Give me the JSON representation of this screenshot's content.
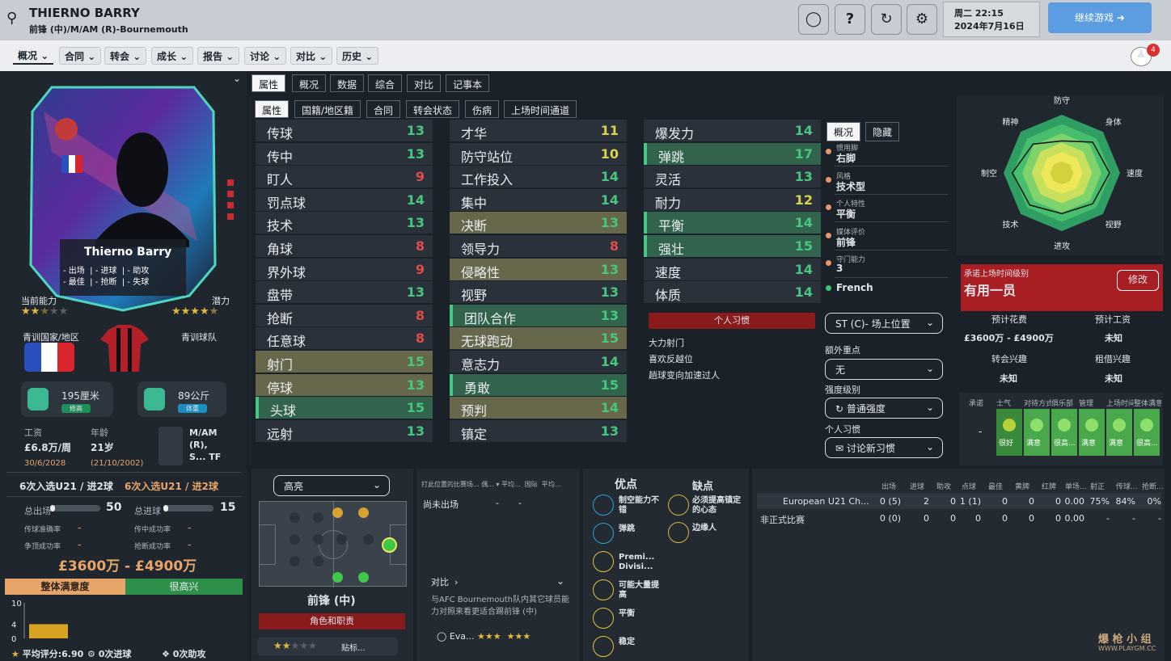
{
  "header": {
    "title": "THIERNO BARRY",
    "subtitle": "前锋 (中)/M/AM (R)-Bournemouth",
    "date_line1": "周二 22:15",
    "date_line2": "2024年7月16日",
    "continue_label": "继续游戏",
    "notif_count": "4"
  },
  "nav": [
    "概况",
    "合同",
    "转会",
    "成长",
    "报告",
    "讨论",
    "对比",
    "历史"
  ],
  "tabs1": [
    "属性",
    "概况",
    "数据",
    "综合",
    "对比",
    "记事本"
  ],
  "tabs2": [
    "属性",
    "国籍/地区籍",
    "合同",
    "转会状态",
    "伤病",
    "上场时间通道"
  ],
  "card": {
    "name": "Thierno Barry",
    "rows": [
      [
        "出场",
        "进球",
        "助攻"
      ],
      [
        "最佳",
        "抢断",
        "失球"
      ]
    ],
    "dash": "-"
  },
  "left": {
    "current_ability": "当前能力",
    "potential": "潜力",
    "youth_nation": "青训国家/地区",
    "youth_team": "青训球队",
    "height": "195厘米",
    "height_tag": "修高",
    "weight": "89公斤",
    "weight_tag": "体重",
    "wage_label": "工资",
    "wage": "£6.8万/周",
    "wage_date": "30/6/2028",
    "age_label": "年龄",
    "age": "21岁",
    "dob": "(21/10/2002)",
    "pos_text": "M/AM (R), S... TF",
    "u21_a": "6次入选U21 / 进2球",
    "u21_b": "6次入选U21 / 进2球",
    "apps_label": "总出场",
    "apps": "50",
    "goals_label": "总进球",
    "goals": "15",
    "stat_rows": [
      [
        "传球准确率",
        "-",
        "传中成功率",
        "-"
      ],
      [
        "争顶成功率",
        "-",
        "抢断成功率",
        "-"
      ]
    ],
    "value": "£3600万 - £4900万",
    "sat_label": "整体满意度",
    "sat_value": "很高兴",
    "avg_rating": "平均评分:6.90",
    "goals_foot": "0次进球",
    "assists_foot": "0次助攻",
    "yticks": [
      "10",
      "4",
      "0"
    ],
    "bar_value": 4
  },
  "attrs_col1": [
    [
      "传球",
      "13",
      "g",
      ""
    ],
    [
      "传中",
      "13",
      "g",
      ""
    ],
    [
      "盯人",
      "9",
      "r",
      ""
    ],
    [
      "罚点球",
      "14",
      "g",
      ""
    ],
    [
      "技术",
      "13",
      "g",
      ""
    ],
    [
      "角球",
      "8",
      "r",
      ""
    ],
    [
      "界外球",
      "9",
      "r",
      ""
    ],
    [
      "盘带",
      "13",
      "g",
      ""
    ],
    [
      "抢断",
      "8",
      "r",
      ""
    ],
    [
      "任意球",
      "8",
      "r",
      ""
    ],
    [
      "射门",
      "15",
      "g",
      "olive"
    ],
    [
      "停球",
      "13",
      "g",
      "olive"
    ],
    [
      "头球",
      "15",
      "g",
      "green"
    ],
    [
      "远射",
      "13",
      "g",
      ""
    ]
  ],
  "attrs_col2": [
    [
      "才华",
      "11",
      "y",
      ""
    ],
    [
      "防守站位",
      "10",
      "y",
      ""
    ],
    [
      "工作投入",
      "14",
      "g",
      ""
    ],
    [
      "集中",
      "14",
      "g",
      ""
    ],
    [
      "决断",
      "13",
      "g",
      "olive"
    ],
    [
      "领导力",
      "8",
      "r",
      ""
    ],
    [
      "侵略性",
      "13",
      "g",
      "olive"
    ],
    [
      "视野",
      "13",
      "g",
      ""
    ],
    [
      "团队合作",
      "13",
      "g",
      "green"
    ],
    [
      "无球跑动",
      "15",
      "g",
      "olive"
    ],
    [
      "意志力",
      "14",
      "g",
      ""
    ],
    [
      "勇敢",
      "15",
      "g",
      "green"
    ],
    [
      "预判",
      "14",
      "g",
      "olive"
    ],
    [
      "镇定",
      "13",
      "g",
      ""
    ]
  ],
  "attrs_col3": [
    [
      "爆发力",
      "14",
      "g",
      ""
    ],
    [
      "弹跳",
      "17",
      "g",
      "green"
    ],
    [
      "灵活",
      "13",
      "g",
      ""
    ],
    [
      "耐力",
      "12",
      "y",
      ""
    ],
    [
      "平衡",
      "14",
      "g",
      "green"
    ],
    [
      "强壮",
      "15",
      "g",
      "green"
    ],
    [
      "速度",
      "14",
      "g",
      ""
    ],
    [
      "体质",
      "14",
      "g",
      ""
    ]
  ],
  "habits": {
    "label": "个人习惯",
    "items": [
      "大力射门",
      "喜欢反越位",
      "趟球变向加速过人"
    ]
  },
  "info": {
    "tab_a": "概况",
    "tab_b": "隐藏",
    "rows": [
      [
        "惯用脚",
        "右脚"
      ],
      [
        "风格",
        "技术型"
      ],
      [
        "个人特性",
        "平衡"
      ],
      [
        "媒体评价",
        "前锋"
      ],
      [
        "守门能力",
        "3"
      ]
    ],
    "nation": "French",
    "role_dd": "ST (C)- 场上位置",
    "extra_label": "额外重点",
    "extra_dd": "无",
    "intensity_label": "强度级别",
    "intensity_dd": "普通强度",
    "habit_label": "个人习惯",
    "habit_dd": "讨论新习惯"
  },
  "radar": {
    "labels": [
      "防守",
      "身体",
      "速度",
      "视野",
      "进攻",
      "技术",
      "制空",
      "精神"
    ],
    "values": [
      0.55,
      0.75,
      0.82,
      0.75,
      0.7,
      0.78,
      0.85,
      0.7
    ]
  },
  "promise": {
    "title": "承诺上场时间级别",
    "value": "有用一员",
    "edit": "修改",
    "cost_label": "预计花费",
    "wage_label": "预计工资",
    "cost": "£3600万 - £4900万",
    "wage": "未知",
    "transfer_label": "转会兴趣",
    "loan_label": "租借兴趣",
    "transfer": "未知",
    "loan": "未知"
  },
  "morale": {
    "headers": [
      "承诺",
      "士气",
      "对待方式",
      "俱乐部",
      "管理",
      "上场时间",
      "整体满意度"
    ],
    "values": [
      "-",
      "很好",
      "满意",
      "很高...",
      "满意",
      "满意",
      "很高..."
    ]
  },
  "highlight": {
    "dd": "高亮",
    "position": "前锋 (中)",
    "role_btn": "角色和职责",
    "role_sel": "贴标..."
  },
  "matches": {
    "headers": [
      "打此位置的比赛场...",
      "偶...",
      "平均...",
      "国际",
      "平均..."
    ],
    "row": [
      "尚未出场",
      "-",
      "-"
    ],
    "compare_label": "对比",
    "compare_text": "与AFC Bournemouth队内其它球员能力对照来看更适合踢前锋 (中)",
    "eva": "Eva..."
  },
  "pros_cons": {
    "pro_title": "优点",
    "con_title": "缺点",
    "pros": [
      "制空能力不错",
      "弹跳",
      "Premi... Divisi...",
      "可能大量提高",
      "平衡",
      "稳定"
    ],
    "cons": [
      "必须提高镇定的心态",
      "边缘人"
    ]
  },
  "stats": {
    "headers": [
      "出场",
      "进球",
      "助攻",
      "点球",
      "最佳",
      "黄牌",
      "红牌",
      "单场...",
      "射正",
      "传球...",
      "抢断..."
    ],
    "rows": [
      [
        "European U21 Ch...",
        "0 (5)",
        "2",
        "0",
        "1 (1)",
        "0",
        "0",
        "0",
        "0.00",
        "75%",
        "84%",
        "0%"
      ],
      [
        "非正式比赛",
        "0 (0)",
        "0",
        "0",
        "0",
        "0",
        "0",
        "0",
        "0.00",
        "-",
        "-",
        "-"
      ]
    ]
  },
  "watermark": {
    "cn": "爆 枪 小 组",
    "url": "WWW.PLAYGM.CC"
  },
  "colors": {
    "accent_green": "#46c77f",
    "olive": "#67674c",
    "warn_red": "#e14a4a",
    "yellow": "#d7d34a",
    "promise_red": "#a81e22"
  }
}
